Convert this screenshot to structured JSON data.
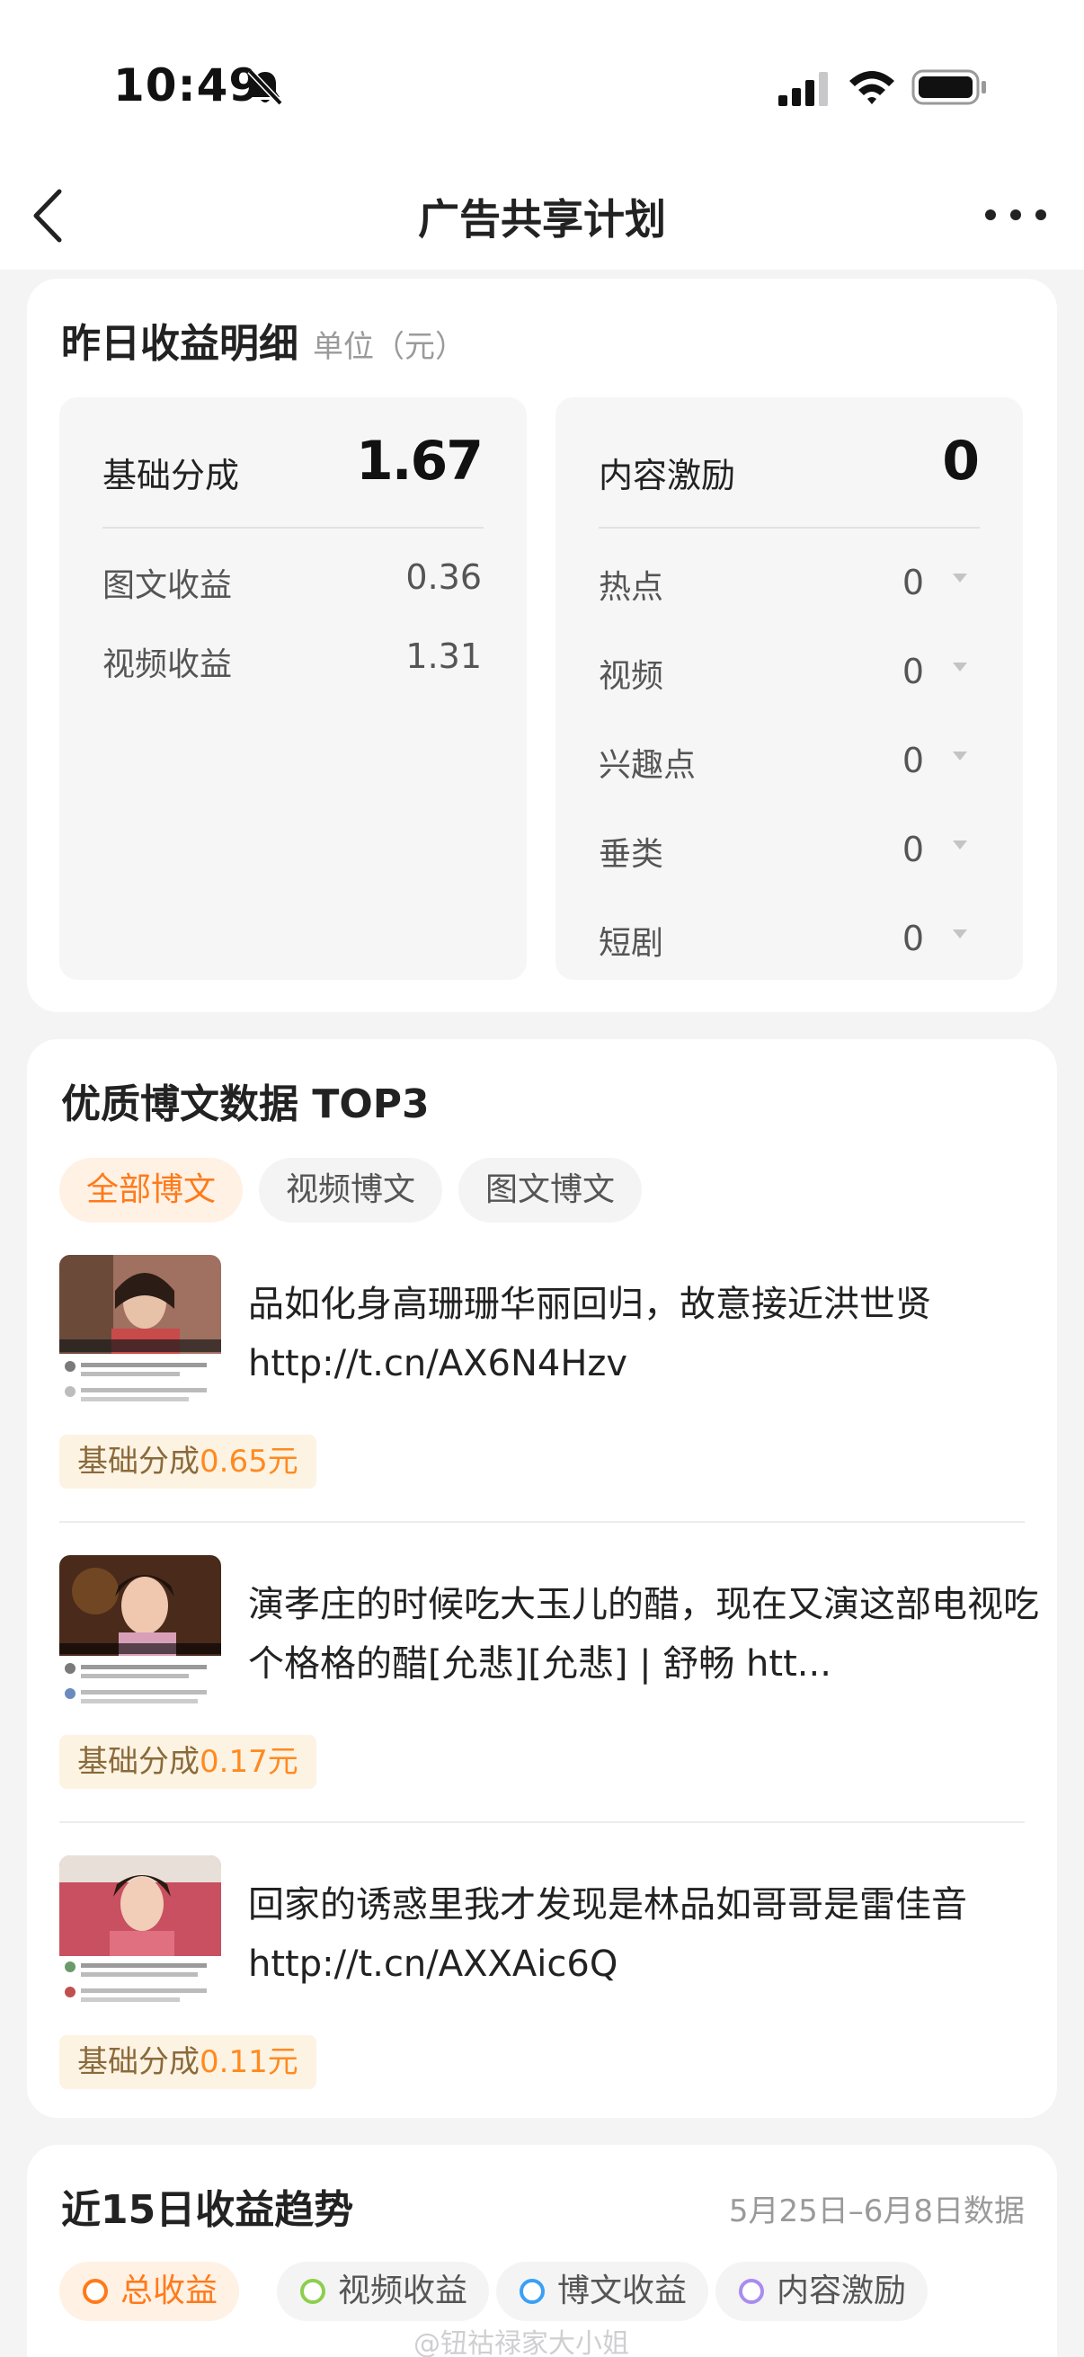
{
  "status_bar": {
    "time": "10:49",
    "icons": [
      "bell-off-icon",
      "signal-icon",
      "wifi-icon",
      "battery-icon"
    ]
  },
  "nav": {
    "title": "广告共享计划",
    "back_icon": "chevron-left-icon",
    "more_icon": "more-dots-icon"
  },
  "income": {
    "title": "昨日收益明细",
    "unit": "单位（元）",
    "basic": {
      "label": "基础分成",
      "value": "1.67",
      "rows": [
        {
          "label": "图文收益",
          "value": "0.36"
        },
        {
          "label": "视频收益",
          "value": "1.31"
        }
      ]
    },
    "content": {
      "label": "内容激励",
      "value": "0",
      "rows": [
        {
          "label": "热点",
          "value": "0"
        },
        {
          "label": "视频",
          "value": "0"
        },
        {
          "label": "兴趣点",
          "value": "0"
        },
        {
          "label": "垂类",
          "value": "0"
        },
        {
          "label": "短剧",
          "value": "0"
        }
      ]
    }
  },
  "top3": {
    "title": "优质博文数据 TOP3",
    "tabs": [
      {
        "label": "全部博文",
        "active": true
      },
      {
        "label": "视频博文",
        "active": false
      },
      {
        "label": "图文博文",
        "active": false
      }
    ],
    "posts": [
      {
        "text": "品如化身高珊珊华丽回归，故意接近洪世贤http://t.cn/AX6N4Hzv",
        "badge_prefix": "基础分成",
        "badge_amount": "0.65元"
      },
      {
        "text": "演孝庄的时候吃大玉儿的醋，现在又演这部电视吃个格格的醋[允悲][允悲] | 舒畅 htt...",
        "badge_prefix": "基础分成",
        "badge_amount": "0.17元"
      },
      {
        "text": "回家的诱惑里我才发现是林品如哥哥是雷佳音 http://t.cn/AXXAic6Q",
        "badge_prefix": "基础分成",
        "badge_amount": "0.11元"
      }
    ]
  },
  "trend": {
    "title": "近15日收益趋势",
    "date_range": "5月25日–6月8日数据",
    "legend": [
      {
        "label": "总收益",
        "color": "#ff7a1a",
        "active": true
      },
      {
        "label": "视频收益",
        "color": "#8ccf4d",
        "active": false
      },
      {
        "label": "博文收益",
        "color": "#3aa0f5",
        "active": false
      },
      {
        "label": "内容激励",
        "color": "#a98cf0",
        "active": false
      }
    ]
  },
  "watermark": "@钮祜禄家大小姐",
  "colors": {
    "accent": "#ff7a1a",
    "badge_bg": "#fdf3e3",
    "card": "#ffffff",
    "background": "#f4f4f5"
  }
}
